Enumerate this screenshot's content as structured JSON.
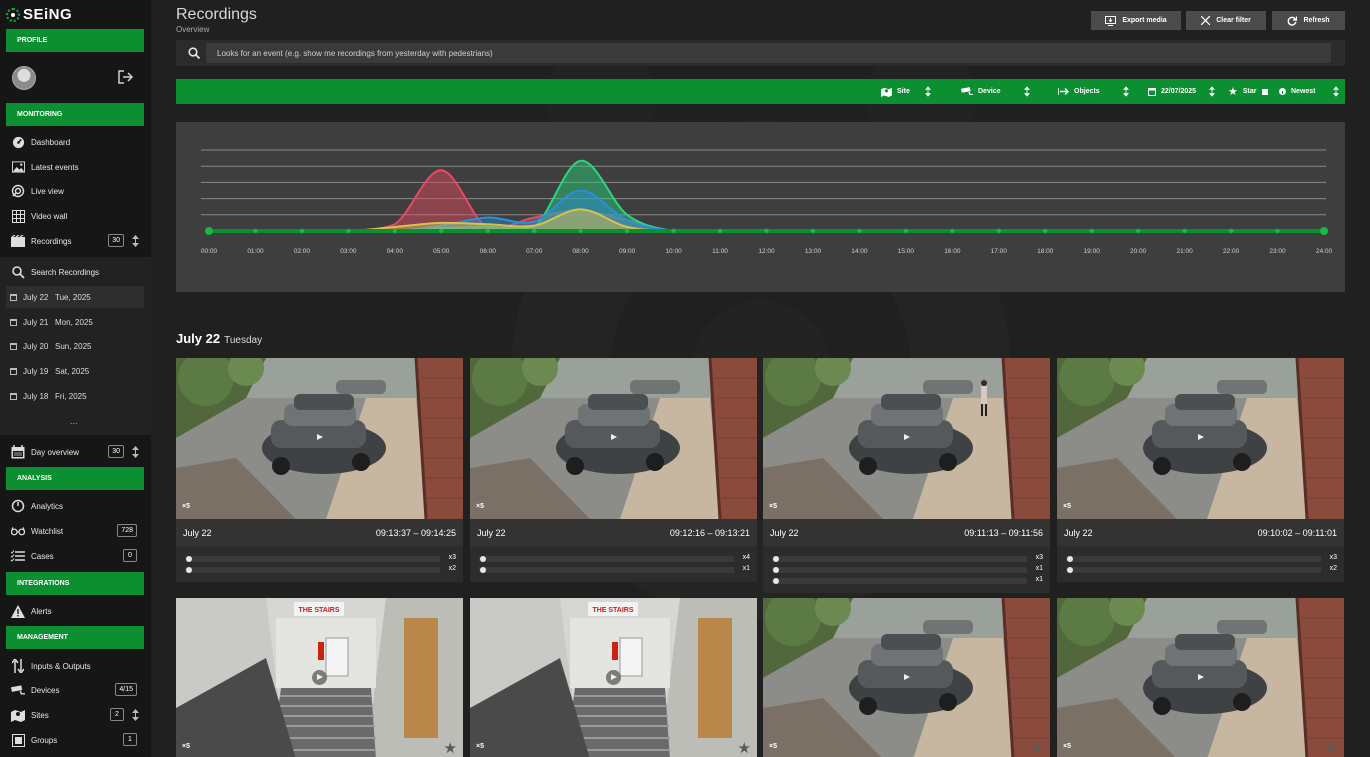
{
  "app": {
    "logo": "SEiNG"
  },
  "sidebar": {
    "profile_head": "PROFILE",
    "monitoring_head": "MONITORING",
    "monitoring": [
      {
        "label": "Dashboard",
        "icon": "gauge-icon"
      },
      {
        "label": "Latest events",
        "icon": "image-icon"
      },
      {
        "label": "Live view",
        "icon": "live-icon"
      },
      {
        "label": "Video wall",
        "icon": "grid-icon"
      },
      {
        "label": "Recordings",
        "icon": "film-icon",
        "badge": "30"
      }
    ],
    "search_recordings": "Search Recordings",
    "days": [
      {
        "date": "July 22",
        "day": "Tue, 2025",
        "active": true
      },
      {
        "date": "July 21",
        "day": "Mon, 2025"
      },
      {
        "date": "July 20",
        "day": "Sun, 2025"
      },
      {
        "date": "July 19",
        "day": "Sat, 2025"
      },
      {
        "date": "July 18",
        "day": "Fri, 2025"
      }
    ],
    "more": "...",
    "day_overview": {
      "label": "Day overview",
      "badge": "30"
    },
    "analysis_head": "ANALYSIS",
    "analysis": [
      {
        "label": "Analytics",
        "icon": "timer-icon"
      },
      {
        "label": "Watchlist",
        "icon": "glasses-icon",
        "badge": "728"
      },
      {
        "label": "Cases",
        "icon": "list-icon",
        "badge": "0"
      }
    ],
    "integrations_head": "INTEGRATIONS",
    "alerts": "Alerts",
    "management_head": "MANAGEMENT",
    "management": [
      {
        "label": "Inputs & Outputs",
        "icon": "io-icon"
      },
      {
        "label": "Devices",
        "icon": "camera-icon",
        "badge": "4/15"
      },
      {
        "label": "Sites",
        "icon": "map-icon",
        "badge": "2"
      },
      {
        "label": "Groups",
        "icon": "group-icon",
        "badge": "1"
      }
    ]
  },
  "header": {
    "title": "Recordings",
    "subtitle": "Overview",
    "export": "Export media",
    "clear": "Clear filter",
    "refresh": "Refresh"
  },
  "search": {
    "placeholder": "Looks for an event (e.g. show me recordings from yesterday with pedestrians)"
  },
  "filters": {
    "site": "Site",
    "device": "Device",
    "objects": "Objects",
    "date": "22/07/2025",
    "star": "Star",
    "sort": "Newest"
  },
  "chart_data": {
    "type": "area",
    "x": [
      "00:00",
      "01:00",
      "02:00",
      "03:00",
      "04:00",
      "05:00",
      "06:00",
      "07:00",
      "08:00",
      "09:00",
      "10:00",
      "11:00",
      "12:00",
      "13:00",
      "14:00",
      "15:00",
      "16:00",
      "17:00",
      "18:00",
      "19:00",
      "20:00",
      "21:00",
      "22:00",
      "23:00",
      "24:00"
    ],
    "series": [
      {
        "color": "#e84a5f",
        "values": [
          0,
          0,
          0,
          0,
          0.5,
          4.5,
          0.2,
          1.0,
          1.5,
          0.8,
          0,
          0,
          0,
          0,
          0,
          0,
          0,
          0,
          0,
          0,
          0,
          0,
          0,
          0,
          0
        ]
      },
      {
        "color": "#2ad67d",
        "values": [
          0,
          0,
          0,
          0,
          0,
          0.2,
          0.3,
          0.3,
          5.2,
          1.2,
          0,
          0,
          0,
          0,
          0,
          0,
          0,
          0,
          0,
          0,
          0,
          0,
          0,
          0,
          0
        ]
      },
      {
        "color": "#2b8fe0",
        "values": [
          0,
          0,
          0,
          0,
          0,
          0.4,
          1.0,
          0.7,
          3.0,
          0.8,
          0,
          0,
          0,
          0,
          0,
          0,
          0,
          0,
          0,
          0,
          0,
          0,
          0,
          0,
          0
        ]
      },
      {
        "color": "#d6c24a",
        "values": [
          0,
          0,
          0,
          0,
          0.3,
          0.6,
          0.5,
          0.4,
          1.6,
          0.3,
          0,
          0,
          0,
          0,
          0,
          0,
          0,
          0,
          0,
          0,
          0,
          0,
          0,
          0,
          0
        ]
      }
    ],
    "ylim": [
      0,
      6
    ],
    "grid": true
  },
  "section": {
    "title": "July 22",
    "subtitle": "Tuesday"
  },
  "recordings": [
    {
      "date": "July 22",
      "time": "09:13:37 – 09:14:25",
      "speed": "×5",
      "scene": "parking",
      "person": false,
      "tracks": [
        "x3",
        "x2"
      ]
    },
    {
      "date": "July 22",
      "time": "09:12:16 – 09:13:21",
      "speed": "×5",
      "scene": "parking",
      "person": false,
      "tracks": [
        "x4",
        "x1"
      ]
    },
    {
      "date": "July 22",
      "time": "09:11:13 – 09:11:56",
      "speed": "×5",
      "scene": "parking",
      "person": true,
      "tracks": [
        "x3",
        "x1",
        "x1"
      ]
    },
    {
      "date": "July 22",
      "time": "09:10:02 – 09:11:01",
      "speed": "×5",
      "scene": "parking",
      "person": false,
      "tracks": [
        "x3",
        "x2"
      ]
    },
    {
      "speed": "×5",
      "scene": "stairs",
      "sign": "THE STAIRS"
    },
    {
      "speed": "×5",
      "scene": "stairs",
      "sign": "THE STAIRS"
    },
    {
      "speed": "×5",
      "scene": "parking"
    },
    {
      "speed": "×5",
      "scene": "parking"
    }
  ],
  "colors": {
    "accent": "#0b8f30",
    "sidebar": "#161616",
    "main": "#202020"
  }
}
